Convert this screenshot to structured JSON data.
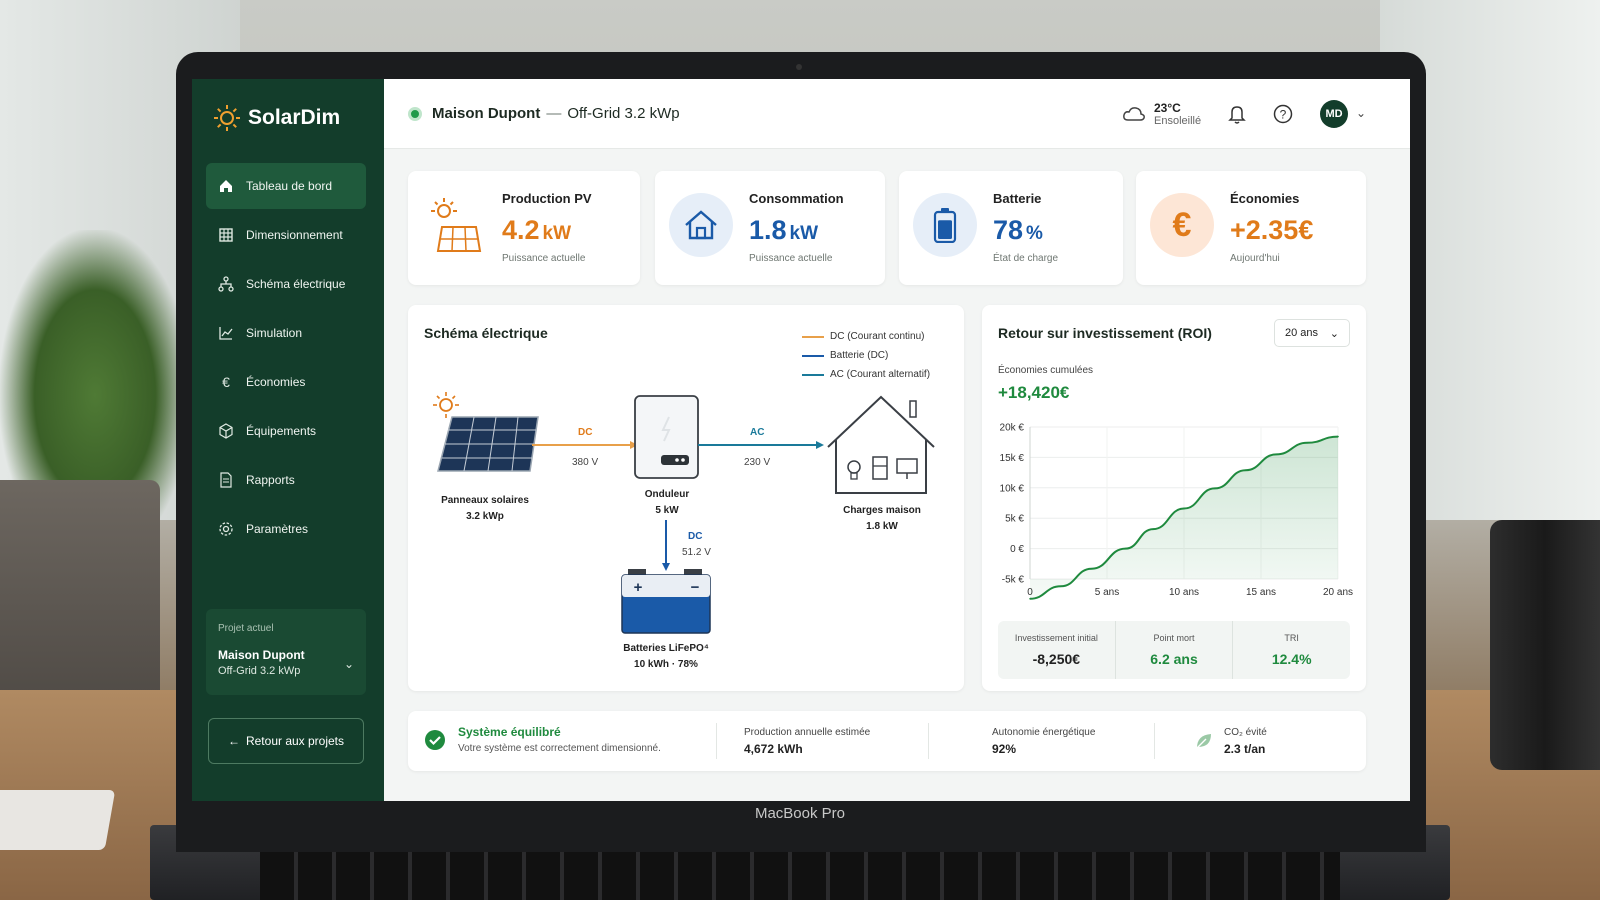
{
  "app": {
    "name": "SolarDim",
    "device_label": "MacBook Pro"
  },
  "sidebar": {
    "items": [
      {
        "label": "Tableau de bord",
        "icon": "home-icon",
        "active": true
      },
      {
        "label": "Dimensionnement",
        "icon": "grid-icon",
        "active": false
      },
      {
        "label": "Schéma électrique",
        "icon": "network-icon",
        "active": false
      },
      {
        "label": "Simulation",
        "icon": "chart-line-icon",
        "active": false
      },
      {
        "label": "Économies",
        "icon": "euro-icon",
        "active": false
      },
      {
        "label": "Équipements",
        "icon": "box-icon",
        "active": false
      },
      {
        "label": "Rapports",
        "icon": "document-icon",
        "active": false
      },
      {
        "label": "Paramètres",
        "icon": "gear-icon",
        "active": false
      }
    ],
    "project": {
      "label": "Projet actuel",
      "name": "Maison Dupont",
      "sub": "Off-Grid 3.2 kWp"
    },
    "back_label": "Retour aux projets"
  },
  "header": {
    "project_name": "Maison Dupont",
    "separator": "—",
    "project_type": "Off-Grid 3.2 kWp",
    "weather": {
      "temp": "23°C",
      "desc": "Ensoleillé"
    },
    "avatar": "MD"
  },
  "kpis": {
    "production": {
      "label": "Production PV",
      "value": "4.2",
      "unit": "kW",
      "sub": "Puissance actuelle",
      "color": "#e07b1a"
    },
    "consumption": {
      "label": "Consommation",
      "value": "1.8",
      "unit": "kW",
      "sub": "Puissance actuelle",
      "color": "#1a5aa8"
    },
    "battery": {
      "label": "Batterie",
      "value": "78",
      "unit": "%",
      "sub": "État de charge",
      "color": "#1a5aa8",
      "level": 0.78
    },
    "savings": {
      "label": "Économies",
      "value": "+2.35€",
      "sub": "Aujourd'hui",
      "color": "#e07b1a"
    }
  },
  "schema": {
    "title": "Schéma électrique",
    "legend": [
      {
        "label": "DC (Courant continu)",
        "color": "#e8a04a"
      },
      {
        "label": "Batterie (DC)",
        "color": "#1a5aa8"
      },
      {
        "label": "AC (Courant alternatif)",
        "color": "#1a7a9a"
      }
    ],
    "panels": {
      "name": "Panneaux solaires",
      "spec": "3.2 kWp"
    },
    "inverter": {
      "name": "Onduleur",
      "spec": "5 kW"
    },
    "house": {
      "name": "Charges maison",
      "spec": "1.8 kW"
    },
    "battery": {
      "name": "Batteries LiFePO⁴",
      "spec": "10 kWh · 78%"
    },
    "links": {
      "dc_tag": "DC",
      "dc_volt": "380 V",
      "ac_tag": "AC",
      "ac_volt": "230 V",
      "bat_tag": "DC",
      "bat_volt": "51.2 V"
    }
  },
  "roi": {
    "title": "Retour sur investissement (ROI)",
    "period": "20 ans",
    "cumulative_label": "Économies cumulées",
    "cumulative_value": "+18,420€",
    "footer": [
      {
        "label": "Investissement initial",
        "value": "-8,250€",
        "color": "#222222"
      },
      {
        "label": "Point mort",
        "value": "6.2 ans",
        "color": "#1f8a3e"
      },
      {
        "label": "TRI",
        "value": "12.4%",
        "color": "#1f8a3e"
      }
    ]
  },
  "chart_data": {
    "type": "area",
    "title": "",
    "xlabel": "",
    "ylabel": "",
    "x": [
      0,
      2,
      4,
      6.2,
      8,
      10,
      12,
      14,
      16,
      18,
      20
    ],
    "x_tick_labels": [
      "0",
      "5 ans",
      "10 ans",
      "15 ans",
      "20 ans"
    ],
    "y_tick_labels": [
      "20k €",
      "15k €",
      "10k €",
      "5k €",
      "0 €",
      "-5k €"
    ],
    "series": [
      {
        "values": [
          -8250,
          -6200,
          -3300,
          0,
          3200,
          6600,
          9900,
          12900,
          15500,
          17400,
          18420
        ],
        "color": "#1f8a3e"
      }
    ],
    "xlim": [
      0,
      20
    ],
    "ylim": [
      -5000,
      20000
    ],
    "grid": true
  },
  "footer": {
    "status_title": "Système équilibré",
    "status_sub": "Votre système est correctement dimensionné.",
    "annual_label": "Production annuelle estimée",
    "annual_value": "4,672 kWh",
    "autonomy_label": "Autonomie énergétique",
    "autonomy_value": "92%",
    "co2_label": "CO₂ évité",
    "co2_value": "2.3 t/an"
  }
}
